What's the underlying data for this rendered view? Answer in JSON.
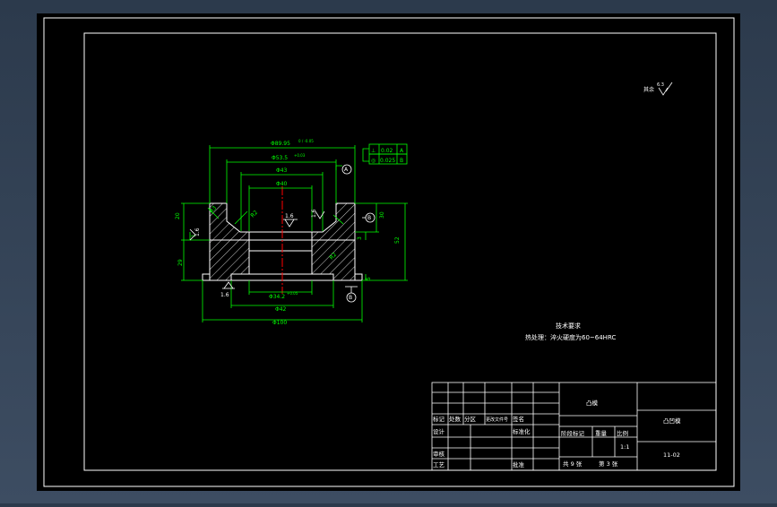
{
  "colors": {
    "background": "#3a495e",
    "sheet": "#000000",
    "frame": "#ffffff",
    "geometry": "#ffffff",
    "dimension": "#00ff00",
    "centerline": "#ff0000",
    "hatch": "#ffffff"
  },
  "drawing": {
    "roughness_note": "其余",
    "roughness_value": "6.3",
    "dims": {
      "outer_top": "Φ89.95",
      "outer_top_tol": "0 / -0.05",
      "mid_top": "Φ53.5",
      "mid_top_tol": "+0.03",
      "bore1": "Φ43",
      "bore2": "Φ40",
      "bottom_bore": "Φ34.2",
      "bottom_bore_tol": "+0.05",
      "bottom_mid": "Φ42",
      "bottom_outer": "Φ100",
      "left_height": "20",
      "left_small": "1",
      "left_lower": "29",
      "right_top": "30",
      "right_total": "52",
      "right_step": "3",
      "right_bottom": "5",
      "chamfer1": "R3",
      "chamfer2": "R2",
      "chamfer3": "R2"
    },
    "roughness": {
      "r1": "1.6",
      "r2": "1.6",
      "r3": "1.6",
      "r4": "1.6",
      "r5": "1.6"
    },
    "tolerance_frames": [
      {
        "symbol": "⊥",
        "value": "0.02",
        "datum": "A"
      },
      {
        "symbol": "◎",
        "value": "0.025",
        "datum": "B"
      }
    ],
    "datums": {
      "a": "A",
      "b": "B",
      "c": "B"
    },
    "tech_req_title": "技术要求",
    "tech_req_line": "热处理：淬火硬度为60~64HRC"
  },
  "title_block": {
    "part_name": "凸模",
    "drawing_no": "凸凹模",
    "material_no": "11-02",
    "scale": "1:1",
    "labels": {
      "mark": "标记",
      "count": "处数",
      "zone": "分区",
      "change_doc": "更改文件号",
      "sign": "签名",
      "design": "设计",
      "standard": "标准化",
      "stage_mark": "阶段标记",
      "weight": "重量",
      "ratio": "比例",
      "review": "审核",
      "process": "工艺",
      "approve": "批准",
      "sheet_total": "共 9 张",
      "sheet_no": "第 3 张"
    }
  }
}
